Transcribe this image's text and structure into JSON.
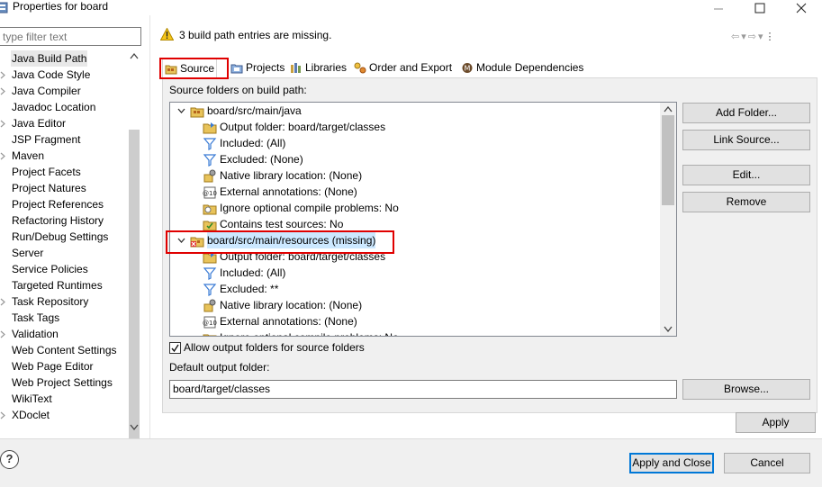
{
  "window": {
    "title": "Properties for board"
  },
  "filter": {
    "placeholder": "type filter text"
  },
  "nav": {
    "items": [
      {
        "label": "Java Build Path",
        "arrow": false,
        "selected": true
      },
      {
        "label": "Java Code Style",
        "arrow": true
      },
      {
        "label": "Java Compiler",
        "arrow": true
      },
      {
        "label": "Javadoc Location",
        "arrow": false
      },
      {
        "label": "Java Editor",
        "arrow": true
      },
      {
        "label": "JSP Fragment",
        "arrow": false
      },
      {
        "label": "Maven",
        "arrow": true
      },
      {
        "label": "Project Facets",
        "arrow": false
      },
      {
        "label": "Project Natures",
        "arrow": false
      },
      {
        "label": "Project References",
        "arrow": false
      },
      {
        "label": "Refactoring History",
        "arrow": false
      },
      {
        "label": "Run/Debug Settings",
        "arrow": false
      },
      {
        "label": "Server",
        "arrow": false
      },
      {
        "label": "Service Policies",
        "arrow": false
      },
      {
        "label": "Targeted Runtimes",
        "arrow": false
      },
      {
        "label": "Task Repository",
        "arrow": true
      },
      {
        "label": "Task Tags",
        "arrow": false
      },
      {
        "label": "Validation",
        "arrow": true
      },
      {
        "label": "Web Content Settings",
        "arrow": false
      },
      {
        "label": "Web Page Editor",
        "arrow": false
      },
      {
        "label": "Web Project Settings",
        "arrow": false
      },
      {
        "label": "WikiText",
        "arrow": false
      },
      {
        "label": "XDoclet",
        "arrow": true
      }
    ]
  },
  "header": {
    "message": "3 build path entries are missing."
  },
  "tabs": [
    {
      "label": "Source",
      "icon": "source-folder-icon"
    },
    {
      "label": "Projects",
      "icon": "projects-icon"
    },
    {
      "label": "Libraries",
      "icon": "libraries-icon"
    },
    {
      "label": "Order and Export",
      "icon": "order-export-icon"
    },
    {
      "label": "Module Dependencies",
      "icon": "module-icon"
    }
  ],
  "source": {
    "folders_label": "Source folders on build path:",
    "tree": [
      {
        "label": "board/src/main/java",
        "level": 0,
        "expanded": true,
        "icon": "package-folder-icon"
      },
      {
        "label": "Output folder: board/target/classes",
        "level": 1,
        "icon": "output-folder-icon"
      },
      {
        "label": "Included: (All)",
        "level": 1,
        "icon": "filter-icon"
      },
      {
        "label": "Excluded: (None)",
        "level": 1,
        "icon": "filter-icon"
      },
      {
        "label": "Native library location: (None)",
        "level": 1,
        "icon": "native-lib-icon"
      },
      {
        "label": "External annotations: (None)",
        "level": 1,
        "icon": "annotations-icon"
      },
      {
        "label": "Ignore optional compile problems: No",
        "level": 1,
        "icon": "ignore-icon"
      },
      {
        "label": "Contains test sources: No",
        "level": 1,
        "icon": "test-sources-icon"
      },
      {
        "label": "board/src/main/resources (missing)",
        "level": 0,
        "expanded": true,
        "icon": "missing-folder-icon",
        "highlight": true
      },
      {
        "label": "Output folder: board/target/classes",
        "level": 1,
        "icon": "output-folder-icon"
      },
      {
        "label": "Included: (All)",
        "level": 1,
        "icon": "filter-icon"
      },
      {
        "label": "Excluded: **",
        "level": 1,
        "icon": "filter-icon"
      },
      {
        "label": "Native library location: (None)",
        "level": 1,
        "icon": "native-lib-icon"
      },
      {
        "label": "External annotations: (None)",
        "level": 1,
        "icon": "annotations-icon"
      },
      {
        "label": "Ignore optional compile problems: No",
        "level": 1,
        "icon": "ignore-icon"
      }
    ],
    "allow_output_label": "Allow output folders for source folders",
    "allow_output_checked": true,
    "default_output_label": "Default output folder:",
    "default_output_value": "board/target/classes"
  },
  "buttons": {
    "add_folder": "Add Folder...",
    "link_source": "Link Source...",
    "edit": "Edit...",
    "remove": "Remove",
    "browse": "Browse...",
    "apply": "Apply",
    "apply_close": "Apply and Close",
    "cancel": "Cancel"
  },
  "colors": {
    "highlight_border": "#e00000",
    "selection": "#cce8ff",
    "default_button": "#0078d7"
  }
}
